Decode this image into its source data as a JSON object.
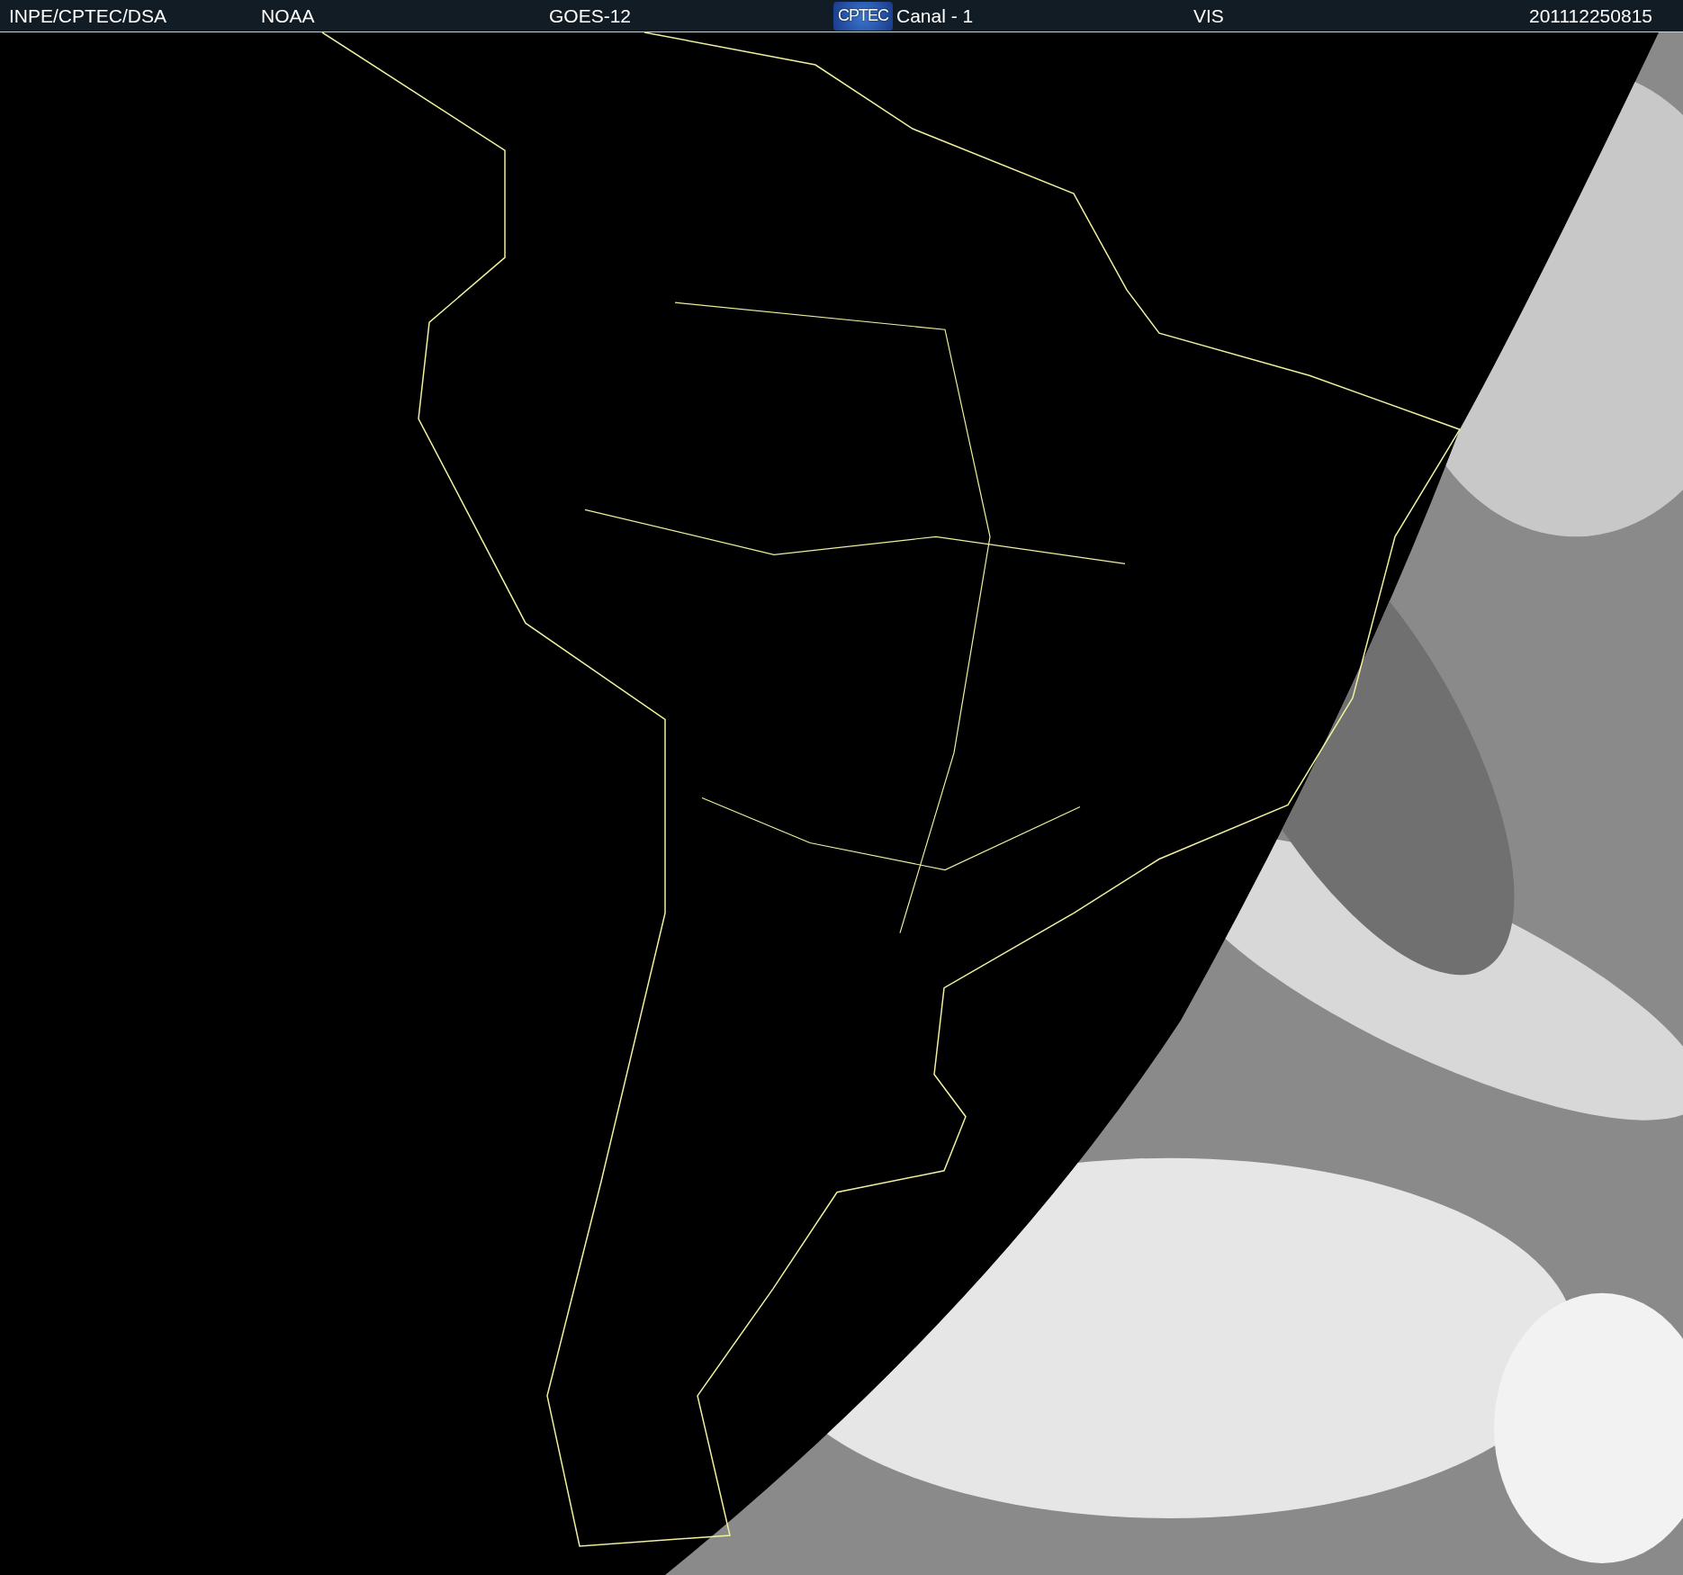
{
  "header": {
    "left_items": [
      "INPE/CPTEC/DSA",
      "NOAA",
      "GOES-12"
    ],
    "logo": "CPTEC",
    "right_items": [
      "Canal - 1",
      "VIS",
      "201112250815"
    ]
  }
}
